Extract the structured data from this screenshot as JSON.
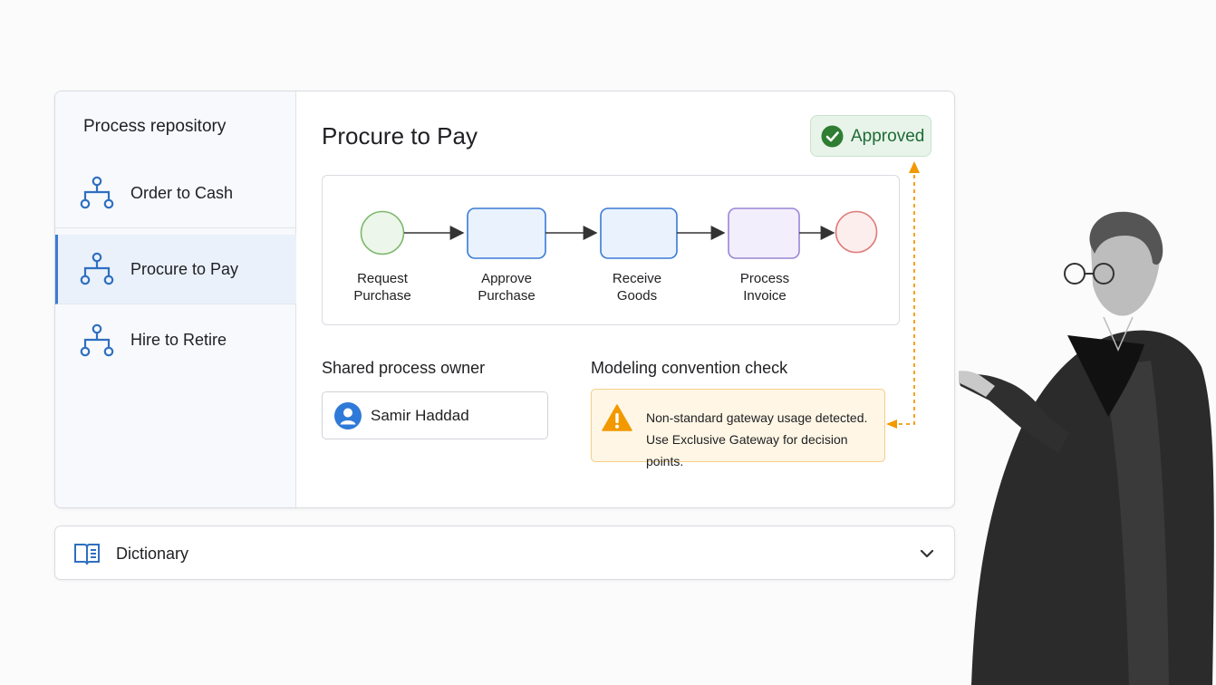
{
  "sidebar": {
    "title": "Process repository",
    "items": [
      {
        "label": "Order to Cash",
        "icon": "process-hierarchy-icon"
      },
      {
        "label": "Procure to Pay",
        "icon": "process-hierarchy-icon",
        "active": true
      },
      {
        "label": "Hire to Retire",
        "icon": "process-hierarchy-icon"
      }
    ]
  },
  "main": {
    "title": "Procure to Pay",
    "status": {
      "label": "Approved",
      "icon": "check-circle-icon",
      "color": "#2e7d32"
    },
    "diagram": {
      "steps": [
        {
          "label_line1": "Request",
          "label_line2": "Purchase",
          "shape": "start-event",
          "color": "#7cb86b"
        },
        {
          "label_line1": "Approve",
          "label_line2": "Purchase",
          "shape": "task",
          "color": "#3a7bd5"
        },
        {
          "label_line1": "Receive",
          "label_line2": "Goods",
          "shape": "task",
          "color": "#3a7bd5"
        },
        {
          "label_line1": "Process",
          "label_line2": "Invoice",
          "shape": "task",
          "color": "#9a86d6"
        },
        {
          "label_line1": "",
          "label_line2": "",
          "shape": "end-event",
          "color": "#e07a7a"
        }
      ]
    },
    "owner": {
      "section_label": "Shared process owner",
      "name": "Samir Haddad",
      "icon": "user-avatar-icon"
    },
    "convention_check": {
      "section_label": "Modeling convention check",
      "line1": "Non-standard gateway usage detected.",
      "line2": "Use Exclusive Gateway for decision points.",
      "icon": "warning-icon",
      "accent": "#f29900"
    }
  },
  "dictionary": {
    "label": "Dictionary",
    "icon": "book-icon",
    "toggle_icon": "chevron-down-icon"
  }
}
